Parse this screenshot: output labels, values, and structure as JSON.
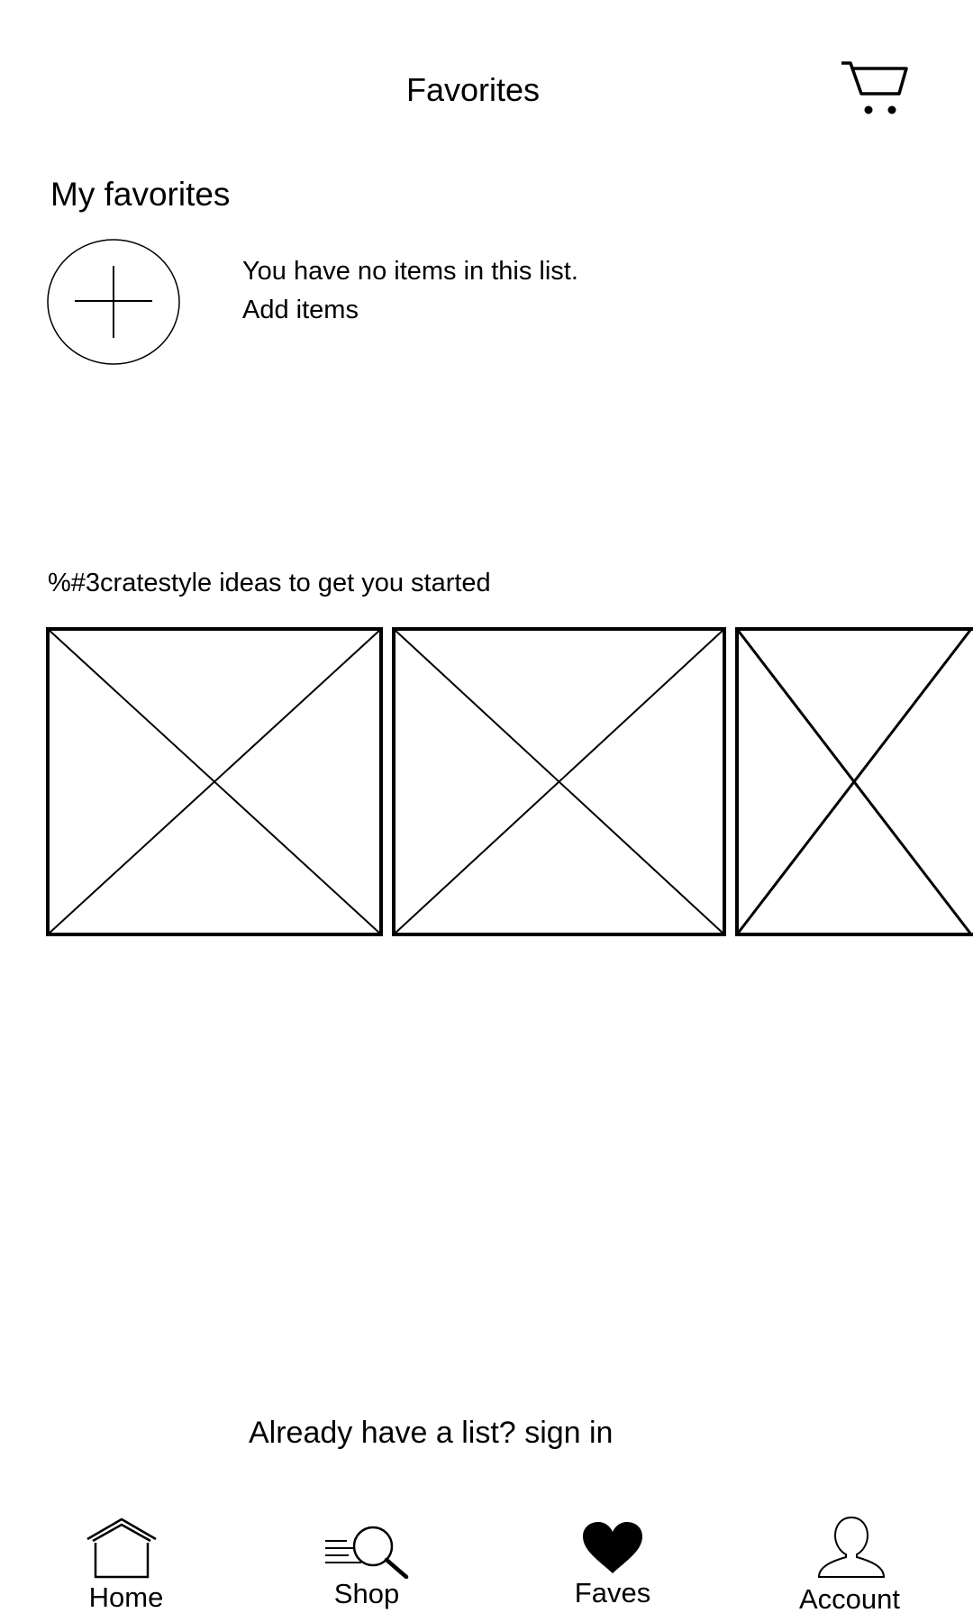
{
  "header": {
    "title": "Favorites",
    "cart_icon": "shopping-cart-icon"
  },
  "favorites": {
    "heading": "My favorites",
    "add_icon": "plus-circle-icon",
    "empty_message": "You have no items in this list.",
    "add_items_label": "Add items"
  },
  "ideas": {
    "heading": "%#3cratestyle ideas to get you started",
    "cards": [
      {
        "icon": "image-placeholder-icon"
      },
      {
        "icon": "image-placeholder-icon"
      },
      {
        "icon": "image-placeholder-icon"
      }
    ]
  },
  "signin": {
    "prompt": "Already have a list?",
    "link_label": "sign in"
  },
  "bottom_nav": {
    "items": [
      {
        "label": "Home",
        "icon": "home-icon",
        "active": false
      },
      {
        "label": "Shop",
        "icon": "search-icon",
        "active": false
      },
      {
        "label": "Faves",
        "icon": "heart-icon",
        "active": true
      },
      {
        "label": "Account",
        "icon": "user-icon",
        "active": false
      }
    ]
  }
}
